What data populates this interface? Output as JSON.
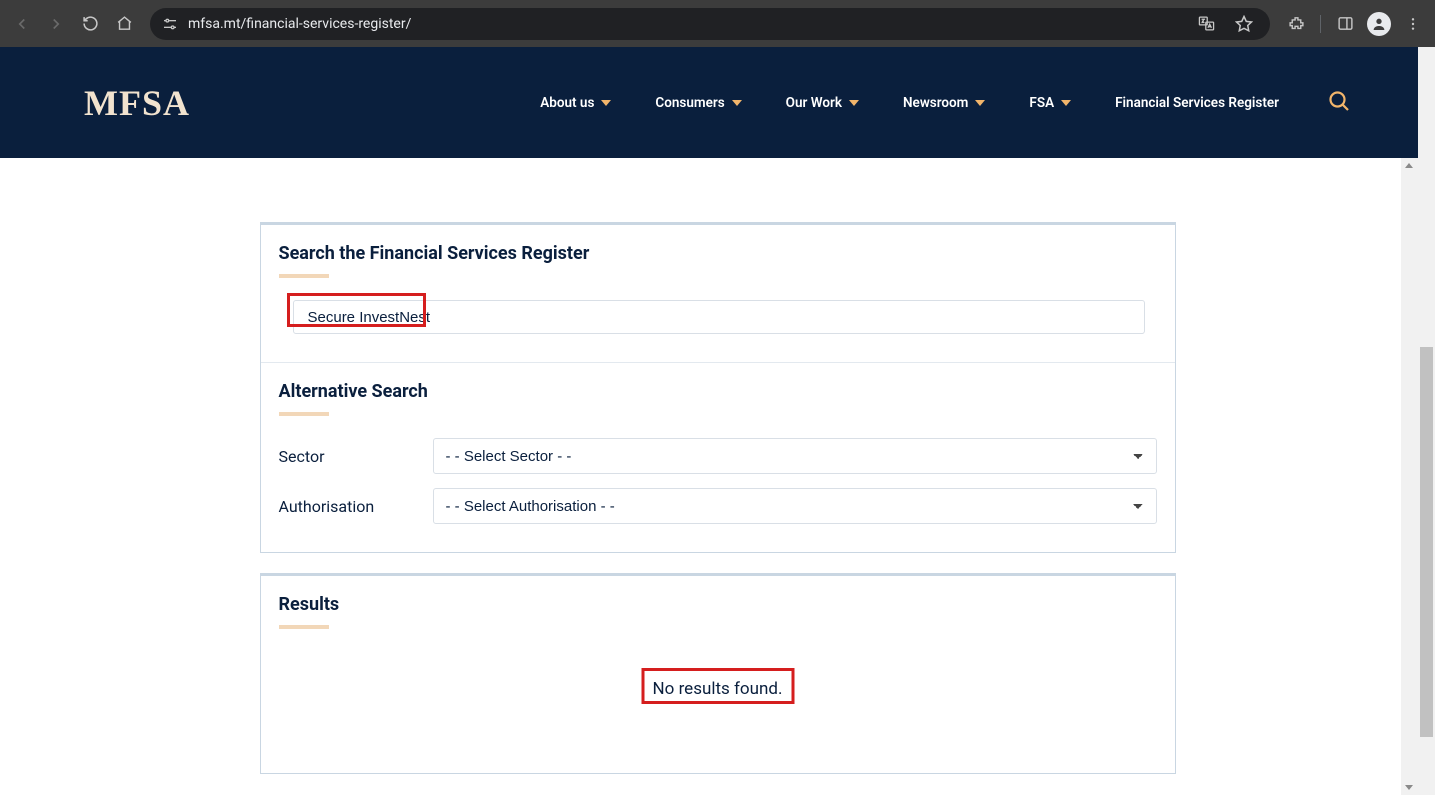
{
  "browser": {
    "url": "mfsa.mt/financial-services-register/"
  },
  "header": {
    "logo": "MFSA",
    "nav": [
      {
        "label": "About us",
        "has_dropdown": true
      },
      {
        "label": "Consumers",
        "has_dropdown": true
      },
      {
        "label": "Our Work",
        "has_dropdown": true
      },
      {
        "label": "Newsroom",
        "has_dropdown": true
      },
      {
        "label": "FSA",
        "has_dropdown": true
      },
      {
        "label": "Financial Services Register",
        "has_dropdown": false
      }
    ]
  },
  "search_panel": {
    "title": "Search the Financial Services Register",
    "input_value": "Secure InvestNest"
  },
  "alt_search": {
    "title": "Alternative Search",
    "rows": {
      "sector": {
        "label": "Sector",
        "selected": "- - Select Sector - -"
      },
      "authorisation": {
        "label": "Authorisation",
        "selected": "- - Select Authorisation - -"
      }
    }
  },
  "results": {
    "title": "Results",
    "message": "No results found."
  }
}
